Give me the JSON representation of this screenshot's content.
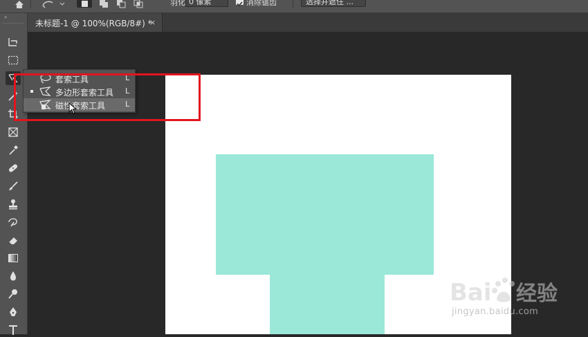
{
  "options_bar": {
    "home_icon": "home-icon",
    "tool_preset_icon": "magnetic-lasso-icon",
    "selection_modes": [
      "new-selection-icon",
      "add-to-selection-icon",
      "subtract-from-selection-icon",
      "intersect-selection-icon"
    ],
    "feather_label": "羽化:",
    "feather_value": "0 像素",
    "antialias_checked": true,
    "antialias_label": "消除锯齿",
    "select_mask_label": "选择并遮住 ..."
  },
  "toolbar": {
    "collapse_glyph": "»",
    "tools": [
      "artboard-icon",
      "marquee-icon",
      "lasso-icon",
      "magic-wand-icon",
      "crop-icon",
      "frame-icon",
      "eyedropper-icon",
      "healing-brush-icon",
      "brush-icon",
      "clone-stamp-icon",
      "history-brush-icon",
      "eraser-icon",
      "gradient-icon",
      "blur-icon",
      "dodge-icon",
      "pen-icon",
      "type-icon"
    ]
  },
  "document": {
    "tab_title": "未标题-1 @ 100%(RGB/8#) *",
    "close_glyph": "×"
  },
  "lasso_flyout": {
    "items": [
      {
        "label": "套索工具",
        "shortcut": "L",
        "icon": "lasso-icon",
        "selected": false,
        "hover": false
      },
      {
        "label": "多边形套索工具",
        "shortcut": "L",
        "icon": "polygonal-lasso-icon",
        "selected": true,
        "hover": false
      },
      {
        "label": "磁性套索工具",
        "shortcut": "L",
        "icon": "magnetic-lasso-icon",
        "selected": false,
        "hover": true
      }
    ]
  },
  "canvas": {
    "background": "#ffffff",
    "shape_color": "#9be8d9"
  },
  "annotation": {
    "highlight_color": "#e3141c"
  },
  "watermark": {
    "brand": "Bai经验",
    "url": "jingyan.baidu.com"
  }
}
